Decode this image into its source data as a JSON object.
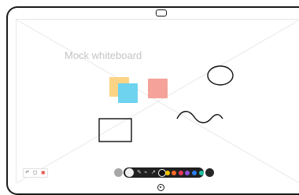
{
  "whiteboard": {
    "title": "Mock whiteboard",
    "notes": [
      {
        "color": "#fcd486"
      },
      {
        "color": "#6dd3ef"
      },
      {
        "color": "#f5a29a"
      }
    ]
  },
  "left_tools": {
    "icons": [
      "undo-icon",
      "layers-icon",
      "trash-icon"
    ]
  },
  "toolbar": {
    "icons": [
      "back-icon",
      "pen-icon",
      "eraser-icon",
      "marker-icon",
      "selector-icon",
      "share-icon"
    ],
    "colors": [
      "#111111",
      "#f2c200",
      "#ff6a2a",
      "#e8385a",
      "#8e51d8",
      "#2d7ff0",
      "#20c3a8",
      "#ffffff"
    ],
    "selected_color": "#111111"
  }
}
